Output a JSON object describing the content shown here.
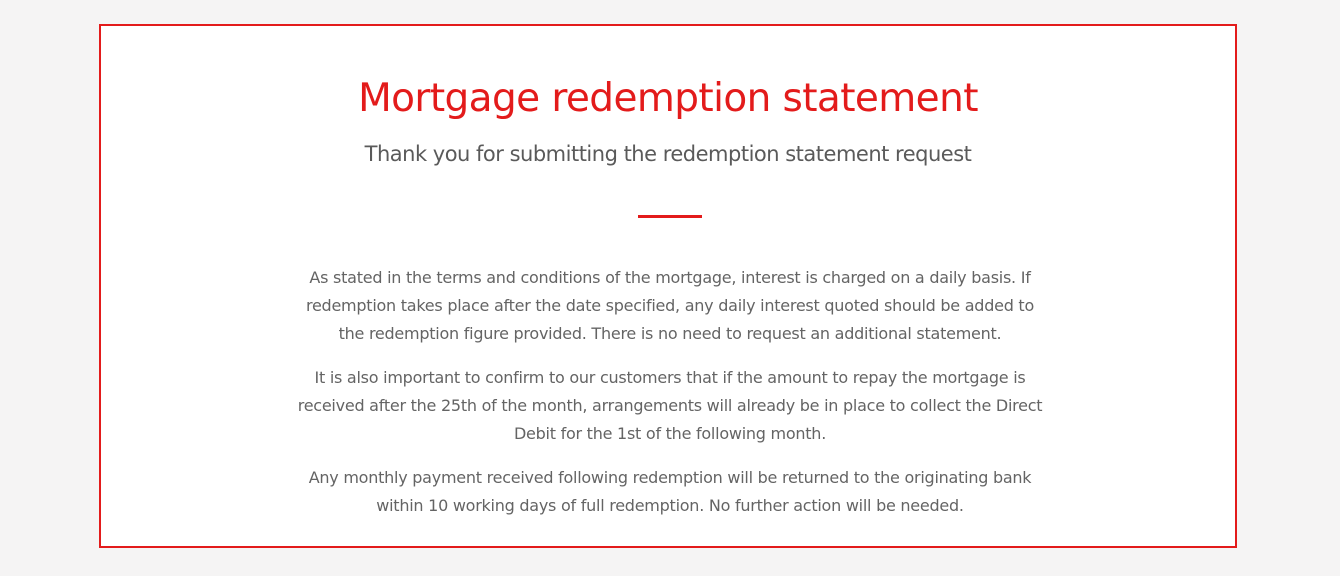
{
  "statement": {
    "title": "Mortgage redemption statement",
    "subtitle": "Thank you for submitting the redemption statement request",
    "paragraphs": [
      "As stated in the terms and conditions of the mortgage, interest is charged on a daily basis. If redemption takes place after the date specified, any daily interest quoted should be added to the redemption figure provided. There is no need to request an additional statement.",
      "It is also important to confirm to our customers that if the amount to repay the mortgage is received after the 25th of the month, arrangements will already be in place to collect the Direct Debit for the 1st of the following month.",
      "Any monthly payment received following redemption will be returned to the originating bank within 10 working days of full redemption. No further action will be needed."
    ]
  },
  "colors": {
    "accent": "#e31b1b",
    "page_background": "#f5f4f4",
    "card_background": "#ffffff",
    "body_text": "#646464",
    "subtitle_text": "#5a5a5a"
  }
}
